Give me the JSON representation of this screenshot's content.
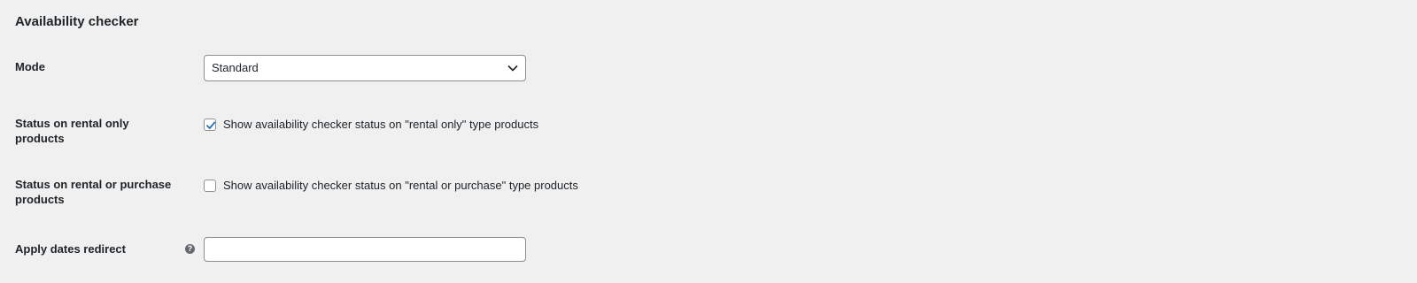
{
  "section": {
    "title": "Availability checker"
  },
  "mode": {
    "label": "Mode",
    "selected": "Standard"
  },
  "status_rental_only": {
    "label": "Status on rental only products",
    "checkbox_label": "Show availability checker status on \"rental only\" type products",
    "checked": true
  },
  "status_rental_or_purchase": {
    "label": "Status on rental or purchase products",
    "checkbox_label": "Show availability checker status on \"rental or purchase\" type products",
    "checked": false
  },
  "apply_dates_redirect": {
    "label": "Apply dates redirect",
    "help_icon": "?",
    "value": ""
  },
  "icons": {
    "select_chevron": "chevron-down-icon",
    "check": "check-icon",
    "help": "question-circle-icon"
  },
  "colors": {
    "background": "#f0f0f1",
    "border": "#8c8f94",
    "check": "#2271b1"
  }
}
